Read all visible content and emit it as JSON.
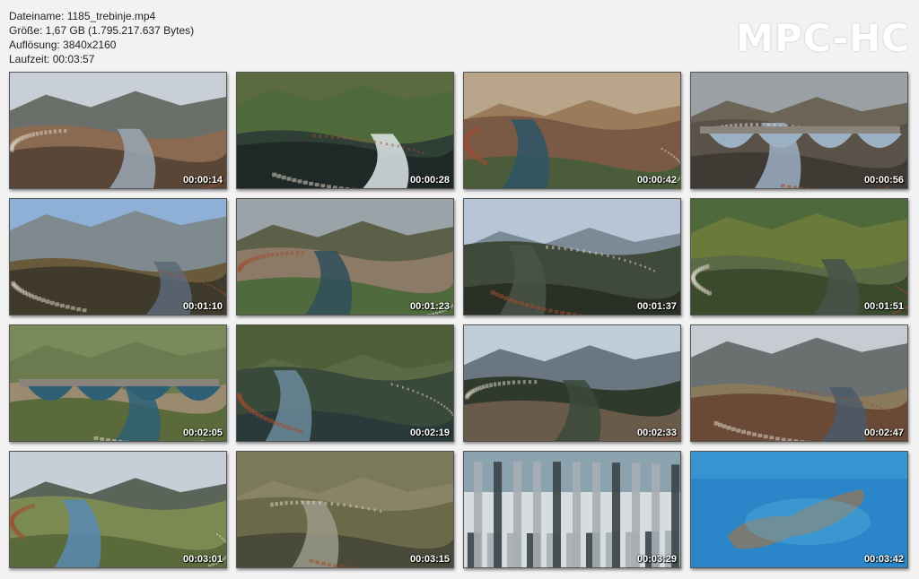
{
  "info": {
    "filename": "Dateiname: 1185_trebinje.mp4",
    "size": "Größe: 1,67 GB (1.795.217.637 Bytes)",
    "resolution": "Auflösung: 3840x2160",
    "duration": "Laufzeit: 00:03:57"
  },
  "logo": "MPC-HC",
  "thumbnails": [
    {
      "time": "00:00:14",
      "scene": "aerial-town-river-mountains"
    },
    {
      "time": "00:00:28",
      "scene": "dam-water-wheel"
    },
    {
      "time": "00:00:42",
      "scene": "river-bridge-town"
    },
    {
      "time": "00:00:56",
      "scene": "stone-arch-bridge"
    },
    {
      "time": "00:01:10",
      "scene": "river-weir-trees"
    },
    {
      "time": "00:01:23",
      "scene": "river-valley-town"
    },
    {
      "time": "00:01:37",
      "scene": "hills-misty"
    },
    {
      "time": "00:01:51",
      "scene": "river-bank-house"
    },
    {
      "time": "00:02:05",
      "scene": "arched-bridge-aerial"
    },
    {
      "time": "00:02:19",
      "scene": "river-stone-weir"
    },
    {
      "time": "00:02:33",
      "scene": "town-hill-mountains"
    },
    {
      "time": "00:02:47",
      "scene": "town-river-panorama"
    },
    {
      "time": "00:03:01",
      "scene": "valley-river-bend"
    },
    {
      "time": "00:03:15",
      "scene": "fields-village"
    },
    {
      "time": "00:03:29",
      "scene": "skyscrapers-city"
    },
    {
      "time": "00:03:42",
      "scene": "island-sea"
    }
  ]
}
